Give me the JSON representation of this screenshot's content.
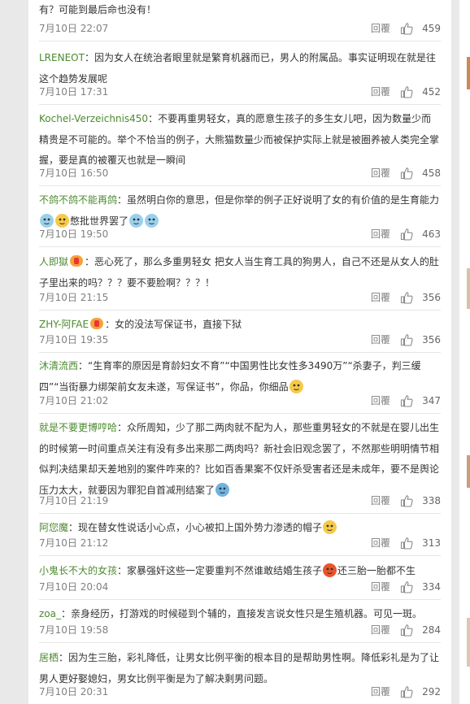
{
  "labels": {
    "reply": "回覆"
  },
  "colors": {
    "username": "#4c8a2f",
    "meta": "#808080",
    "text": "#333333"
  },
  "comments": [
    {
      "user": "",
      "sep": "",
      "text": "有？可能到最后命也没有！",
      "time": "7月10日 22:07",
      "likes": "459"
    },
    {
      "user": "LRENEOT",
      "sep": "：",
      "text": "因为女人在统治者眼里就是繁育机器而已，男人的附属品。事实证明现在就是往这个趋势发展呢",
      "time": "7月10日 17:31",
      "likes": "452"
    },
    {
      "user": "Kochel-Verzeichnis450",
      "sep": "：",
      "text": "不要再重男轻女，真的愿意生孩子的多生女儿吧，因为数量少而精贵是不可能的。举个不恰当的例子，大熊猫数量少而被保护实际上就是被圈养被人类完全掌握，要是真的被覆灭也就是一瞬间",
      "time": "7月10日 16:50",
      "likes": "458"
    },
    {
      "user": "不鸽不鸽不能再鸽",
      "sep": "：",
      "text": "虽然明白你的意思，但是你举的例子正好说明了女的有价值的是生育能力",
      "text2": "憋批世界罢了",
      "time": "7月10日 19:50",
      "likes": "463"
    },
    {
      "user": "人即獄",
      "sep": "：",
      "text": "恶心死了，那么多重男轻女 把女人当生育工具的狗男人，自己不还是从女人的肚子里出来的吗？？？要不要脸啊？？？！",
      "time": "7月10日 21:15",
      "likes": "356"
    },
    {
      "user": "ZHY-阿FAE",
      "sep": "：",
      "text": "女的没法写保证书，直接下狱",
      "time": "7月10日 19:35",
      "likes": "356"
    },
    {
      "user": "沐清流西",
      "sep": "：",
      "text": "“生育率的原因是育龄妇女不育”“中国男性比女性多3490万”“杀妻子，判三缓四”“当街暴力绑架前女友未遂，写保证书”，你品，你细品",
      "time": "7月10日 21:02",
      "likes": "347"
    },
    {
      "user": "就是不要更博哼哈",
      "sep": "：",
      "text": "众所周知，少了那二两肉就不配为人，那些重男轻女的不就是在婴儿出生的时候第一时间重点关注有没有多出来那二两肉吗？新社会旧观念罢了，不然那些明明情节相似判决结果却天差地别的案件咋来的？比如百香果案不仅奸杀受害者还是未成年，要不是舆论压力太大，就要因为罪犯自首减刑结案了",
      "time": "7月10日 21:19",
      "likes": "338"
    },
    {
      "user": "阿您魔",
      "sep": "：",
      "text": "现在替女性说话小心点，小心被扣上国外势力渗透的帽子",
      "time": "7月10日 21:12",
      "likes": "313"
    },
    {
      "user": "小鬼长不大的女孩",
      "sep": "：",
      "text": "家暴强奸这些一定要重判不然谁敢结婚生孩子",
      "text2": "还三胎一胎都不生",
      "time": "7月10日 20:04",
      "likes": "334"
    },
    {
      "user": "zoa_",
      "sep": "：",
      "text": "亲身经历，打游戏的时候碰到个辅的，直接发言说女性只是生殖机器。可见一斑。",
      "time": "7月10日 19:58",
      "likes": "284"
    },
    {
      "user": "居栖",
      "sep": "：",
      "text": "因为生三胎，彩礼降低，让男女比例平衡的根本目的是帮助男性啊。降低彩礼是为了让男人更好娶媳妇，男女比例平衡是为了解决剩男问题。",
      "time": "7月10日 20:31",
      "likes": "292"
    }
  ]
}
